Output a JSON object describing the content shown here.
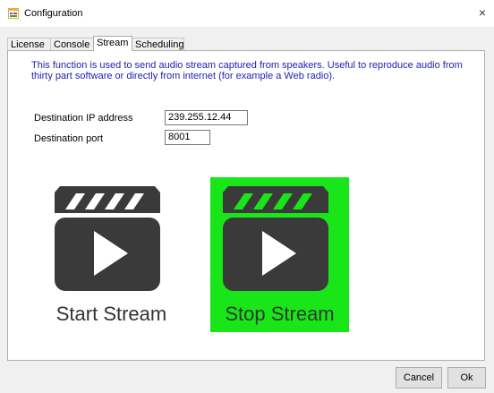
{
  "window": {
    "title": "Configuration",
    "close_glyph": "×"
  },
  "tabs": [
    {
      "label": "License",
      "active": false
    },
    {
      "label": "Console",
      "active": false
    },
    {
      "label": "Stream",
      "active": true
    },
    {
      "label": "Scheduling",
      "active": false
    }
  ],
  "stream": {
    "description": "This function is used to send audio stream captured from speakers. Useful to reproduce audio from thirty part software or directly from internet (for example a Web radio).",
    "ip_label": "Destination IP address",
    "ip_value": "239.255.12.44",
    "port_label": "Destination port",
    "port_value": "8001",
    "start_label": "Start Stream",
    "stop_label": "Stop Stream"
  },
  "buttons": {
    "cancel": "Cancel",
    "ok": "Ok"
  },
  "colors": {
    "description_text": "#2121b6",
    "stop_background": "#19e619",
    "start_background": "#ffffff",
    "clapper_icon": "#3a3a3a"
  },
  "icons": {
    "app": "window-icon",
    "start": "clapperboard-play-icon",
    "stop": "clapperboard-play-icon"
  }
}
